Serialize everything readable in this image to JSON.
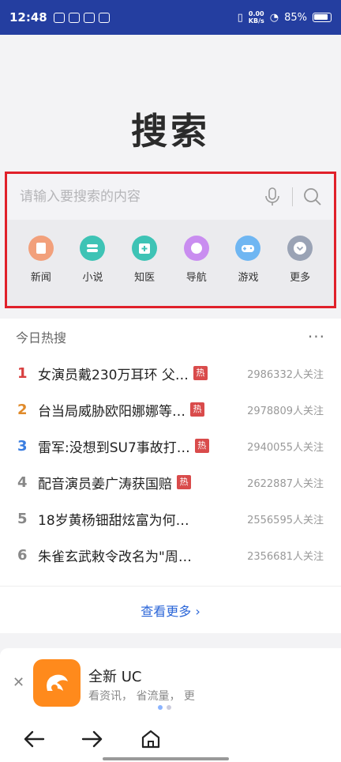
{
  "status_bar": {
    "time": "12:48",
    "speed_value": "0.00",
    "speed_unit": "KB/s",
    "battery": "85%"
  },
  "logo": "搜索",
  "search": {
    "placeholder": "请输入要搜索的内容",
    "mic_icon": "microphone-icon",
    "search_icon": "magnifier-icon"
  },
  "shortcuts": [
    {
      "label": "新闻",
      "color": "#f2a07b",
      "icon": "news-icon"
    },
    {
      "label": "小说",
      "color": "#3ec3b5",
      "icon": "novel-icon"
    },
    {
      "label": "知医",
      "color": "#3ec3b5",
      "icon": "medical-icon"
    },
    {
      "label": "导航",
      "color": "#c98df0",
      "icon": "navigation-icon"
    },
    {
      "label": "游戏",
      "color": "#6fb6f2",
      "icon": "gamepad-icon"
    },
    {
      "label": "更多",
      "color": "#9aa3b5",
      "icon": "chevron-down-icon"
    }
  ],
  "hot": {
    "title": "今日热搜",
    "badge_text": "热",
    "items": [
      {
        "rank": "1",
        "title": "女演员戴230万耳环 父…",
        "hot": true,
        "count": "2986332人关注",
        "rank_color": "#d84040"
      },
      {
        "rank": "2",
        "title": "台当局威胁欧阳娜娜等…",
        "hot": true,
        "count": "2978809人关注",
        "rank_color": "#e08a2a"
      },
      {
        "rank": "3",
        "title": "雷军:没想到SU7事故打…",
        "hot": true,
        "count": "2940055人关注",
        "rank_color": "#3a7de0"
      },
      {
        "rank": "4",
        "title": "配音演员姜广涛获国赔",
        "hot": true,
        "count": "2622887人关注",
        "rank_color": "#888888"
      },
      {
        "rank": "5",
        "title": "18岁黄杨钿甜炫富为何…",
        "hot": false,
        "count": "2556595人关注",
        "rank_color": "#888888"
      },
      {
        "rank": "6",
        "title": "朱雀玄武敕令改名为\"周…",
        "hot": false,
        "count": "2356681人关注",
        "rank_color": "#888888"
      }
    ],
    "see_more": "查看更多"
  },
  "banner": {
    "title": "全新 UC",
    "subtitle": "看资讯， 省流量， 更"
  },
  "colors": {
    "accent": "#2b66d8",
    "highlight_border": "#e0202a",
    "status_bar": "#243ea0",
    "uc_orange": "#ff8a1c"
  }
}
